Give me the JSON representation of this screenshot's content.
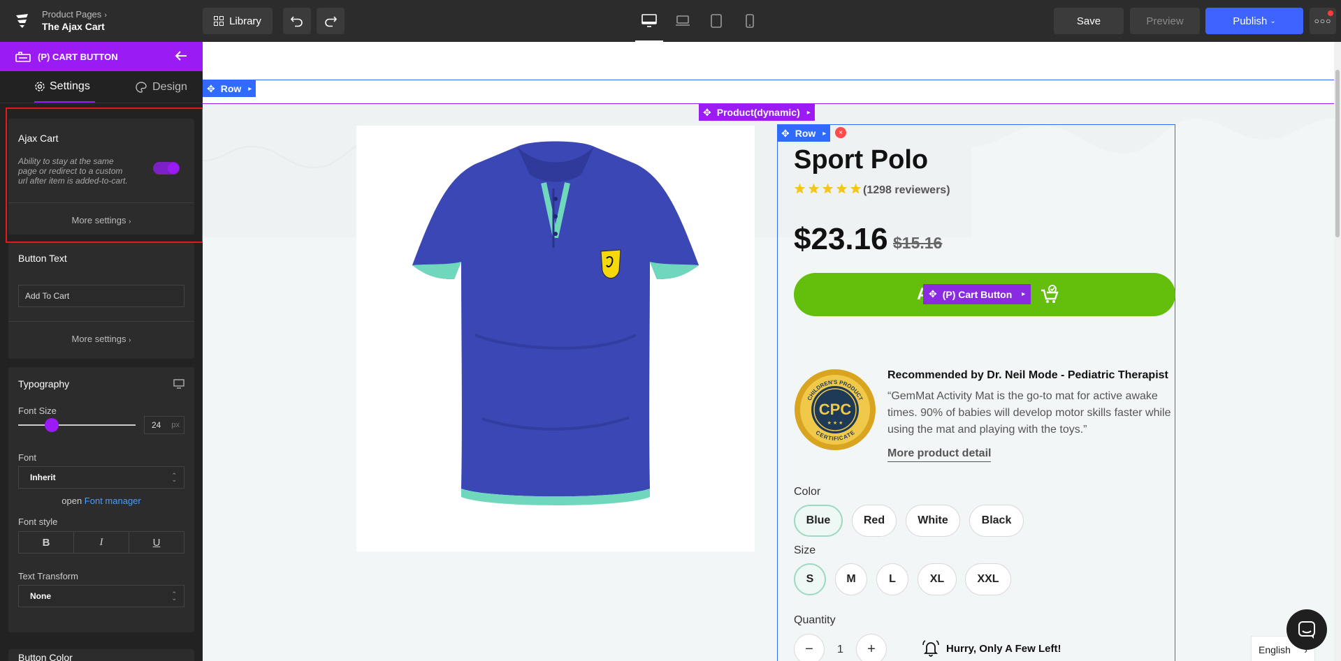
{
  "header": {
    "breadcrumb": "Product Pages",
    "page_name": "The Ajax Cart",
    "library_label": "Library",
    "save_label": "Save",
    "preview_label": "Preview",
    "publish_label": "Publish"
  },
  "sidebar": {
    "element_title": "(P) CART BUTTON",
    "tabs": {
      "settings": "Settings",
      "design": "Design"
    },
    "ajax": {
      "title": "Ajax Cart",
      "description": "Ability to stay at the same page or redirect to a custom url after item is added-to-cart.",
      "enabled": true,
      "more_settings": "More settings"
    },
    "button_text": {
      "title": "Button Text",
      "value": "Add To Cart",
      "more_settings": "More settings"
    },
    "typography": {
      "title": "Typography",
      "font_size_label": "Font Size",
      "font_size_value": "24",
      "font_size_unit": "px",
      "font_label": "Font",
      "font_value": "Inherit",
      "font_manager_prefix": "open",
      "font_manager_link": "Font manager",
      "font_style_label": "Font style",
      "text_transform_label": "Text Transform",
      "text_transform_value": "None"
    },
    "next_panel_title": "Button Color"
  },
  "canvas": {
    "row_tag": "Row",
    "product_tag": "Product(dynamic)",
    "inner_row_tag": "Row",
    "cart_tag": "(P) Cart Button",
    "product": {
      "title": "Sport Polo",
      "rating": 5,
      "reviews": "(1298 reviewers)",
      "price": "$23.16",
      "compare_price": "$15.16",
      "cart_button_text": "AI",
      "badge_top": "CHILDREN'S PRODUCT",
      "badge_center": "CPC",
      "badge_bottom": "CERTIFICATE",
      "rec_title": "Recommended by Dr. Neil Mode - Pediatric Therapist",
      "rec_quote": "“GemMat Activity Mat is the go-to mat for active awake times. 90% of babies will develop motor skills faster while using the mat and playing with the toys.”",
      "more_detail": "More product detail",
      "color_label": "Color",
      "colors": [
        "Blue",
        "Red",
        "White",
        "Black"
      ],
      "size_label": "Size",
      "sizes": [
        "S",
        "M",
        "L",
        "XL",
        "XXL"
      ],
      "quantity_label": "Quantity",
      "quantity_value": "1",
      "hurry_text": "Hurry, Only A Few Left!"
    },
    "language": "English"
  },
  "colors": {
    "accent_purple": "#9b1bf5",
    "row_blue": "#2f6bff",
    "cart_green": "#63bf0b",
    "publish_blue": "#3d63ff",
    "star_yellow": "#f5c518",
    "shirt_blue": "#3a47b4",
    "shirt_trim": "#6fd8bc"
  }
}
